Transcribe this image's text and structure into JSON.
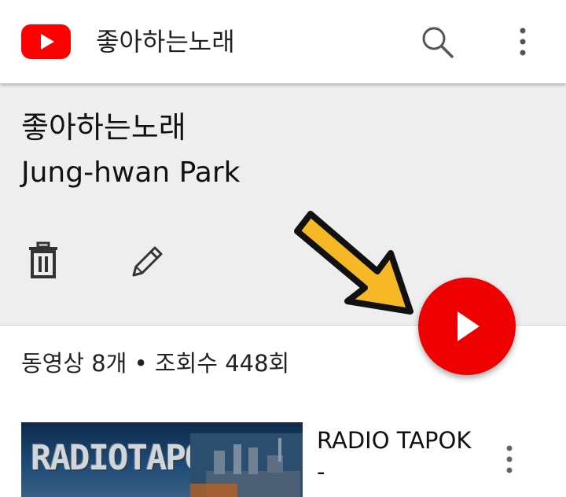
{
  "app": {
    "title": "좋아하는노래",
    "logo_icon": "youtube-logo-icon",
    "search_icon": "search-icon",
    "more_icon": "more-vert-icon"
  },
  "playlist": {
    "title": "좋아하는노래",
    "owner": "Jung-hwan Park",
    "stats": "동영상 8개 • 조회수 448회",
    "actions": [
      {
        "icon": "trash-icon"
      },
      {
        "icon": "pencil-icon"
      }
    ],
    "play_all_icon": "play-icon"
  },
  "videos": [
    {
      "title": "RADIO TAPOK -",
      "thumbnail_text": "RADIOTAPOK"
    }
  ],
  "colors": {
    "brand_red": "#ff0000",
    "header_bg": "#eeeeee",
    "annotation_arrow": "#f7b825"
  }
}
